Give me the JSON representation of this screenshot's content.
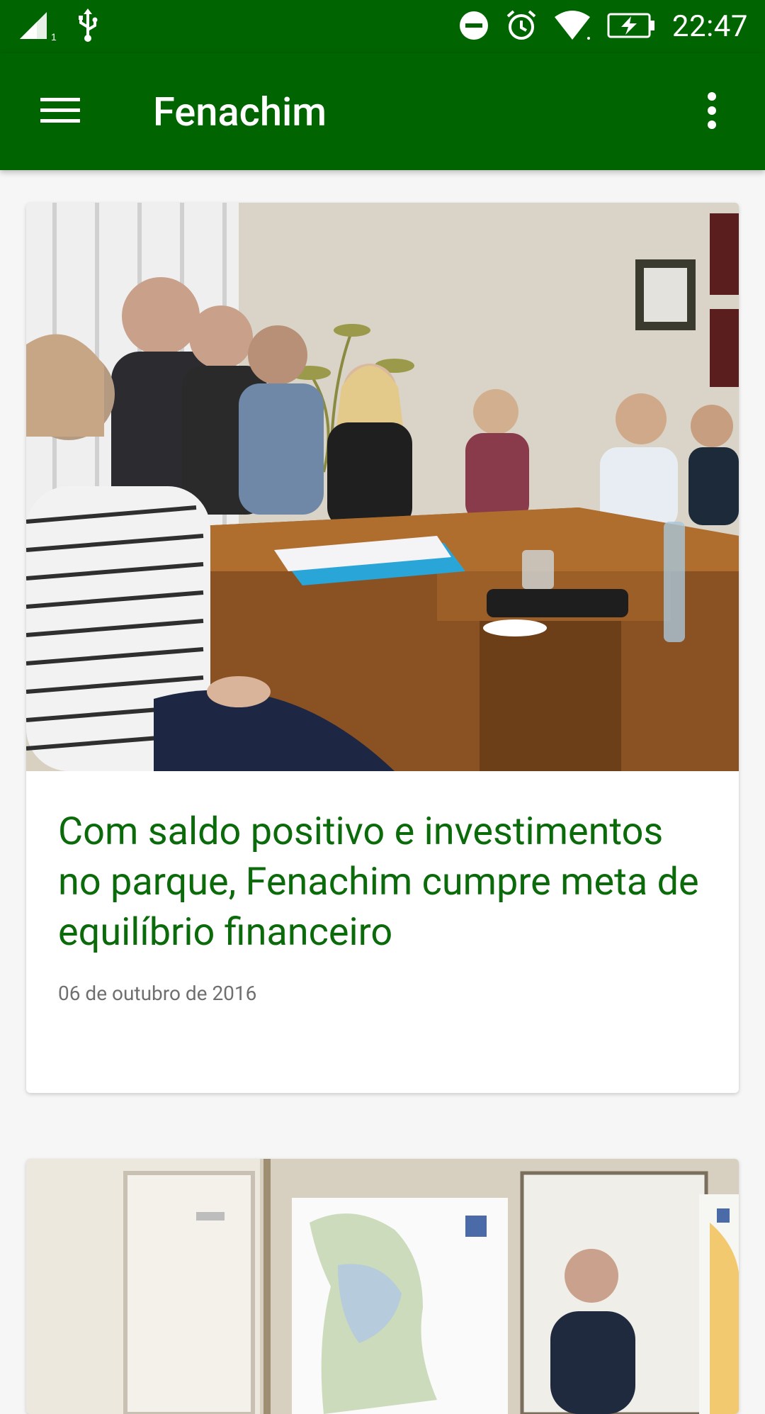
{
  "status_bar": {
    "time": "22:47",
    "sim_slot": "1",
    "icons": [
      "signal-icon",
      "usb-icon",
      "do-not-disturb-icon",
      "alarm-icon",
      "wifi-icon",
      "battery-charging-icon"
    ]
  },
  "app_bar": {
    "title": "Fenachim",
    "menu_icon": "hamburger-menu-icon",
    "overflow_icon": "more-vert-icon"
  },
  "colors": {
    "primary": "#006400",
    "headline": "#0b6b0b",
    "background": "#f6f6f6",
    "card": "#ffffff",
    "date_text": "#6f6f6f"
  },
  "feed": {
    "articles": [
      {
        "image": "meeting-photo",
        "headline": "Com saldo positivo e investimentos no parque, Fenachim cumpre meta de equilíbrio financeiro",
        "date": "06 de outubro de 2016"
      },
      {
        "image": "map-office-photo"
      }
    ]
  }
}
